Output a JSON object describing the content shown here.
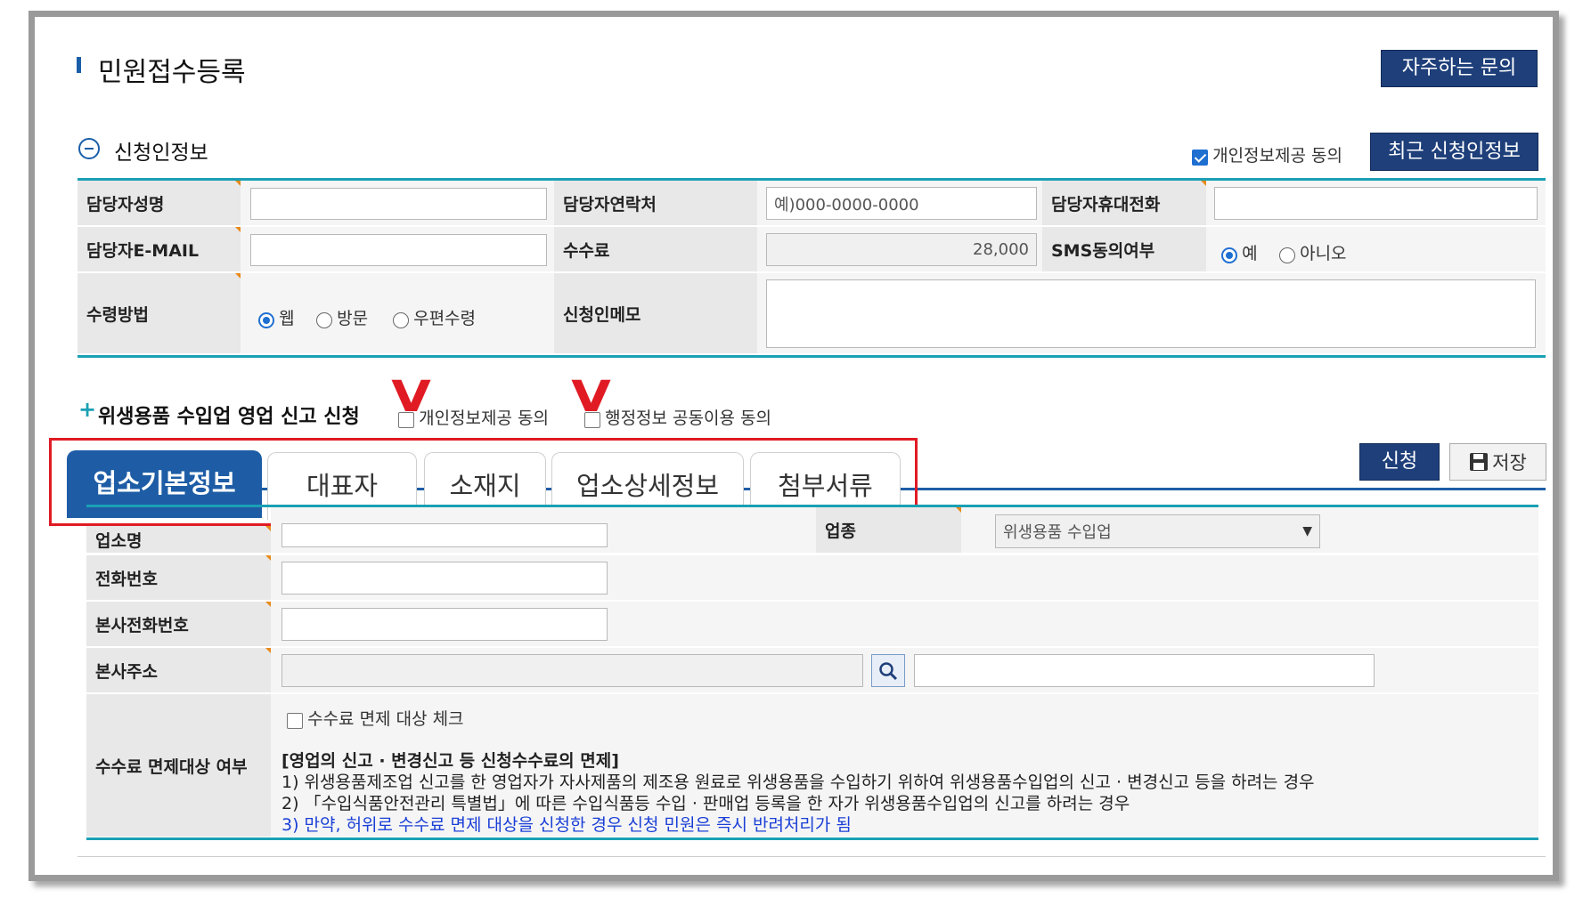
{
  "page": {
    "title": "민원접수등록",
    "faq_label": "자주하는 문의"
  },
  "applicant": {
    "section_title": "신청인정보",
    "privacy_consent_label": "개인정보제공 동의",
    "privacy_consent_checked": true,
    "recent_button_label": "최근 신청인정보",
    "rows": {
      "manager_name_label": "담당자성명",
      "manager_contact_label": "담당자연락처",
      "manager_contact_placeholder": "예)000-0000-0000",
      "manager_mobile_label": "담당자휴대전화",
      "manager_email_label": "담당자E-MAIL",
      "fee_label": "수수료",
      "fee_value": "28,000",
      "sms_label": "SMS동의여부",
      "sms_options": [
        "예",
        "아니오"
      ],
      "sms_selected": "예",
      "receive_label": "수령방법",
      "receive_options": [
        "웹",
        "방문",
        "우편수령"
      ],
      "receive_selected": "웹",
      "memo_label": "신청인메모"
    }
  },
  "application": {
    "section_title": "위생용품 수입업 영업 신고 신청",
    "privacy_consent_label": "개인정보제공 동의",
    "admin_info_label": "행정정보 공동이용 동의",
    "annotation_mark": "V",
    "submit_label": "신청",
    "save_label": "저장",
    "tabs": [
      "업소기본정보",
      "대표자",
      "소재지",
      "업소상세정보",
      "첨부서류"
    ],
    "active_tab": "업소기본정보"
  },
  "business": {
    "name_label": "업소명",
    "industry_label": "업종",
    "industry_value": "위생용품 수입업",
    "phone_label": "전화번호",
    "hq_phone_label": "본사전화번호",
    "hq_address_label": "본사주소",
    "fee_exempt_label": "수수료 면제대상 여부",
    "fee_exempt_check_label": "수수료 면제 대상 체크",
    "notes": {
      "heading": "[영업의 신고 · 변경신고 등 신청수수료의 면제]",
      "line1": "1) 위생용품제조업 신고를 한 영업자가 자사제품의 제조용 원료로 위생용품을 수입하기 위하여 위생용품수입업의 신고 · 변경신고 등을 하려는 경우",
      "line2": "2) 「수입식품안전관리 특별법」에 따른 수입식품등 수입 · 판매업 등록을 한 자가 위생용품수입업의 신고를 하려는 경우",
      "line3": "3) 만약, 허위로 수수료 면제 대상을 신청한 경우 신청 민원은 즉시 반려처리가 됨"
    }
  },
  "colors": {
    "navy": "#1e3f7a",
    "tab_active": "#1e5da6",
    "teal": "#1aa0b4",
    "highlight_red": "#e01b24",
    "note_blue": "#1a3fd6"
  }
}
